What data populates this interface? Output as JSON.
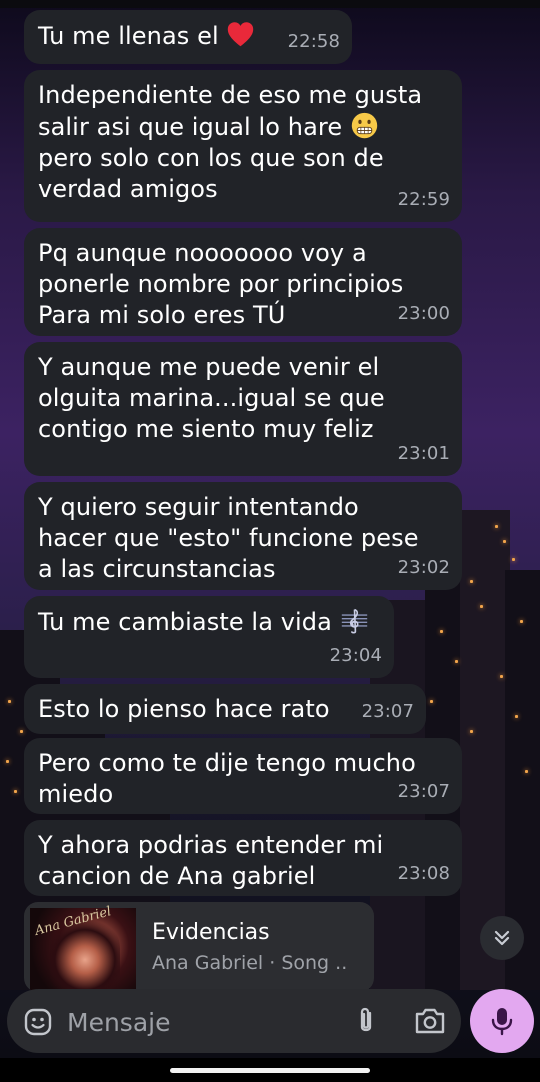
{
  "messages": [
    {
      "text": "Tu me llenas el",
      "time": "22:58",
      "emoji": "heart-emoji"
    },
    {
      "text_before": "Independiente de eso me gusta\nsalir asi que igual lo hare ",
      "text_after": "\npero solo con los que son de\nverdad amigos",
      "time": "22:59",
      "emoji": "grimacing-face-emoji"
    },
    {
      "text": "Pq aunque nooooooo voy a\nponerle nombre por principios\nPara mi solo eres TÚ",
      "time": "23:00"
    },
    {
      "text": "Y aunque me puede venir el\nolguita marina...igual se que\ncontigo me siento muy feliz",
      "time": "23:01"
    },
    {
      "text": "Y quiero seguir intentando\nhacer que \"esto\" funcione pese\na las circunstancias",
      "time": "23:02"
    },
    {
      "text": "Tu me cambiaste la vida ",
      "time": "23:04",
      "emoji": "musical-score-emoji"
    },
    {
      "text": "Esto lo pienso hace rato",
      "time": "23:07"
    },
    {
      "text": "Pero como te dije tengo mucho\nmiedo",
      "time": "23:07"
    },
    {
      "text": "Y ahora podrias entender mi\ncancion de Ana gabriel",
      "time": "23:08"
    }
  ],
  "shared_song": {
    "title": "Evidencias",
    "subtitle": "Ana Gabriel · Song ..",
    "cover_signature": "Ana Gabriel"
  },
  "composer": {
    "placeholder": "Mensaje"
  },
  "colors": {
    "bubble": "#212328",
    "timestamp": "#a9adb5",
    "mic_button": "#e3a8f0",
    "composer": "#2a2b2f"
  },
  "icons": [
    "emoji-icon",
    "attach-icon",
    "camera-icon",
    "mic-icon",
    "scroll-down-icon"
  ]
}
